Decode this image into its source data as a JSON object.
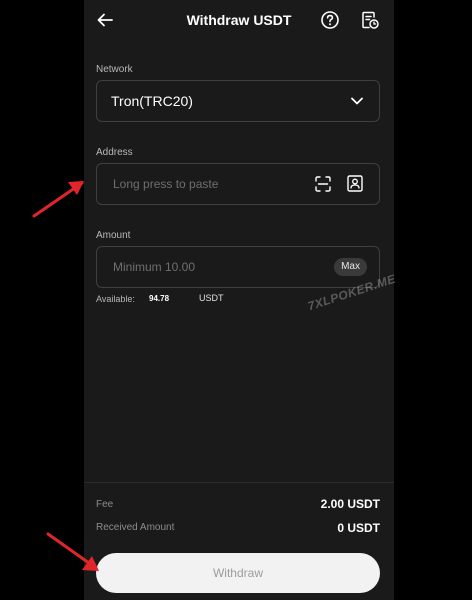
{
  "header": {
    "title": "Withdraw USDT"
  },
  "network": {
    "label": "Network",
    "value": "Tron(TRC20)"
  },
  "address": {
    "label": "Address",
    "placeholder": "Long press to paste"
  },
  "amount": {
    "label": "Amount",
    "placeholder": "Minimum 10.00",
    "max_label": "Max",
    "available_label": "Available:",
    "available_value": "94.78",
    "available_unit": "USDT"
  },
  "watermark": "7XLPOKER.ME",
  "summary": {
    "fee_label": "Fee",
    "fee_value": "2.00 USDT",
    "received_label": "Received Amount",
    "received_value": "0 USDT"
  },
  "actions": {
    "withdraw_label": "Withdraw"
  },
  "colors": {
    "background": "#000000",
    "panel": "#1a1a1a",
    "annotation_arrow": "#e0262b",
    "button": "#f2f2f2"
  },
  "icons": [
    "back-arrow-icon",
    "help-icon",
    "history-icon",
    "chevron-down-icon",
    "scan-icon",
    "contact-book-icon"
  ]
}
